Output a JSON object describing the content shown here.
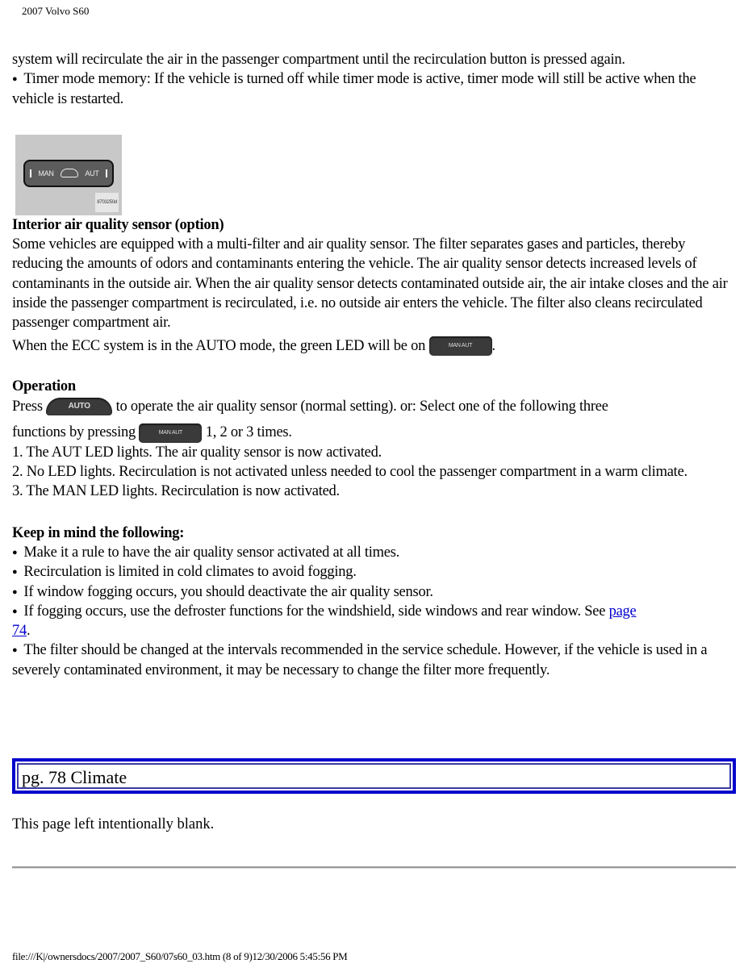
{
  "header": {
    "title": "2007 Volvo S60"
  },
  "intro": {
    "line1": "system will recirculate the air in the passenger compartment until the recirculation button is pressed again.",
    "bullet_timer": "Timer mode memory: If the vehicle is turned off while timer mode is active, timer mode will still be active when the vehicle is restarted."
  },
  "figure": {
    "left_label": "MAN",
    "right_label": "AUT",
    "code": "8703250d"
  },
  "sensor": {
    "heading": "Interior air quality sensor (option)",
    "body": "Some vehicles are equipped with a multi-filter and air quality sensor. The filter separates gases and particles, thereby reducing the amounts of odors and contaminants entering the vehicle. The air quality sensor detects increased levels of contaminants in the outside air. When the air quality sensor detects contaminated outside air, the air intake closes and the air inside the passenger compartment is recirculated, i.e. no outside air enters the vehicle. The filter also cleans recirculated passenger compartment air.",
    "auto_mode_text": "When the ECC system is in the AUTO mode, the green LED will be on",
    "auto_mode_end": "."
  },
  "operation": {
    "heading": "Operation",
    "press": "Press",
    "press_rest": "to operate the air quality sensor (normal setting). or: Select one of the following three",
    "functions": "functions by pressing",
    "functions_rest": "1, 2 or 3 times.",
    "auto_button_label": "AUTO",
    "ecc_button_label": "MAN  AUT",
    "steps": [
      "1. The AUT LED lights. The air quality sensor is now activated.",
      "2. No LED lights. Recirculation is not activated unless needed to cool the passenger compartment in a warm climate.",
      "3. The MAN LED lights. Recirculation is now activated."
    ]
  },
  "keep_in_mind": {
    "heading": "Keep in mind the following:",
    "bullets": [
      "Make it a rule to have the air quality sensor activated at all times.",
      "Recirculation is limited in cold climates to avoid fogging.",
      "If window fogging occurs, you should deactivate the air quality sensor."
    ],
    "fog_bullet_text": "If fogging occurs, use the defroster functions for the windshield, side windows and rear window. See",
    "fog_link_1": "page ",
    "fog_link_2": "74",
    "fog_end": ".",
    "filter_bullet": "The filter should be changed at the intervals recommended in the service schedule. However, if the vehicle is used in a severely contaminated environment, it may be necessary to change the filter more frequently."
  },
  "page_box": {
    "label": "pg. 78 Climate"
  },
  "blank_note": "This page left intentionally blank.",
  "footer": {
    "path": "file:///K|/ownersdocs/2007/2007_S60/07s60_03.htm (8 of 9)12/30/2006 5:45:56 PM"
  },
  "colors": {
    "link": "#0000cc",
    "page_box_border": "#0000cc"
  }
}
